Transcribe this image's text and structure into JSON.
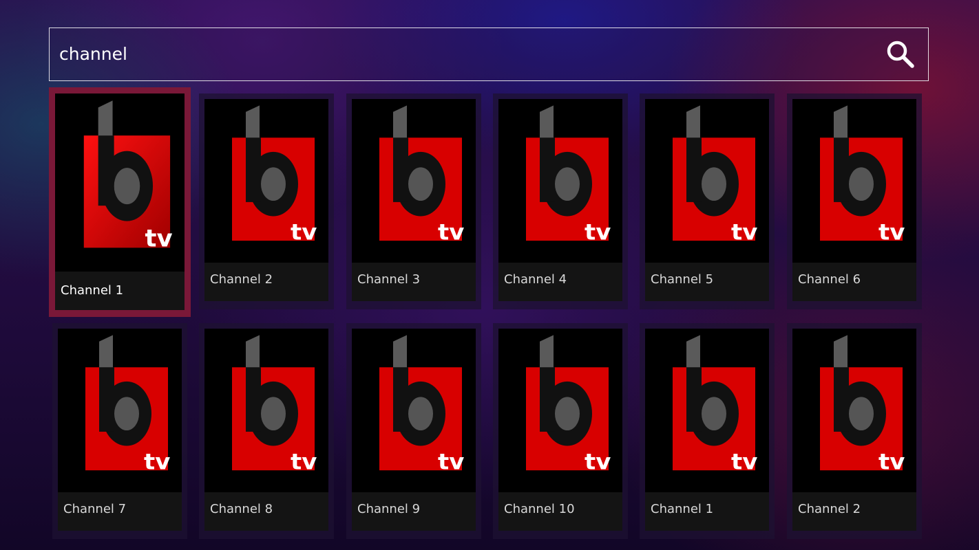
{
  "search": {
    "value": "channel",
    "button_icon": "search-icon"
  },
  "channels": [
    {
      "label": "Channel 1",
      "logo": "btv-logo"
    },
    {
      "label": "Channel 2",
      "logo": "btv-logo"
    },
    {
      "label": "Channel 3",
      "logo": "btv-logo"
    },
    {
      "label": "Channel 4",
      "logo": "btv-logo"
    },
    {
      "label": "Channel 5",
      "logo": "btv-logo"
    },
    {
      "label": "Channel 6",
      "logo": "btv-logo"
    },
    {
      "label": "Channel 7",
      "logo": "btv-logo"
    },
    {
      "label": "Channel 8",
      "logo": "btv-logo"
    },
    {
      "label": "Channel 9",
      "logo": "btv-logo"
    },
    {
      "label": "Channel 10",
      "logo": "btv-logo"
    },
    {
      "label": "Channel 1",
      "logo": "btv-logo"
    },
    {
      "label": "Channel 2",
      "logo": "btv-logo"
    }
  ],
  "colors": {
    "focus_border": "#7a1838",
    "logo_red": "#e00000",
    "card_label_bg": "#141414"
  }
}
